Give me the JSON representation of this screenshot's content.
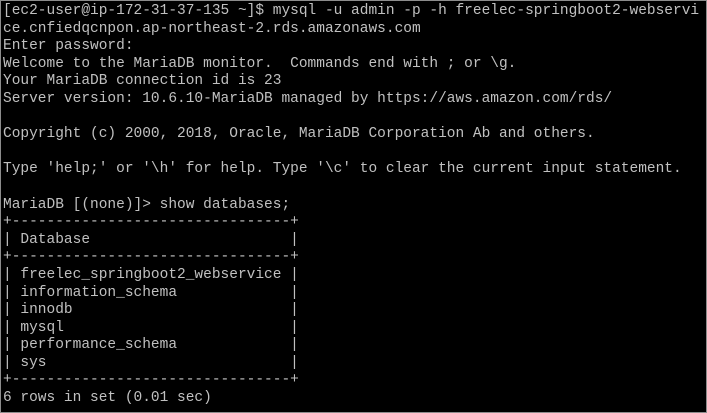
{
  "terminal": {
    "text_color": "#c0c0c0",
    "background_color": "#000000",
    "lines": [
      "[ec2-user@ip-172-31-37-135 ~]$ mysql -u admin -p -h freelec-springboot2-webservi",
      "ce.cnfiedqcnpon.ap-northeast-2.rds.amazonaws.com",
      "Enter password:",
      "Welcome to the MariaDB monitor.  Commands end with ; or \\g.",
      "Your MariaDB connection id is 23",
      "Server version: 10.6.10-MariaDB managed by https://aws.amazon.com/rds/",
      "",
      "Copyright (c) 2000, 2018, Oracle, MariaDB Corporation Ab and others.",
      "",
      "Type 'help;' or '\\h' for help. Type '\\c' to clear the current input statement.",
      "",
      "MariaDB [(none)]> show databases;",
      "+--------------------------------+",
      "| Database                       |",
      "+--------------------------------+",
      "| freelec_springboot2_webservice |",
      "| information_schema             |",
      "| innodb                         |",
      "| mysql                          |",
      "| performance_schema             |",
      "| sys                            |",
      "+--------------------------------+",
      "6 rows in set (0.01 sec)"
    ]
  }
}
